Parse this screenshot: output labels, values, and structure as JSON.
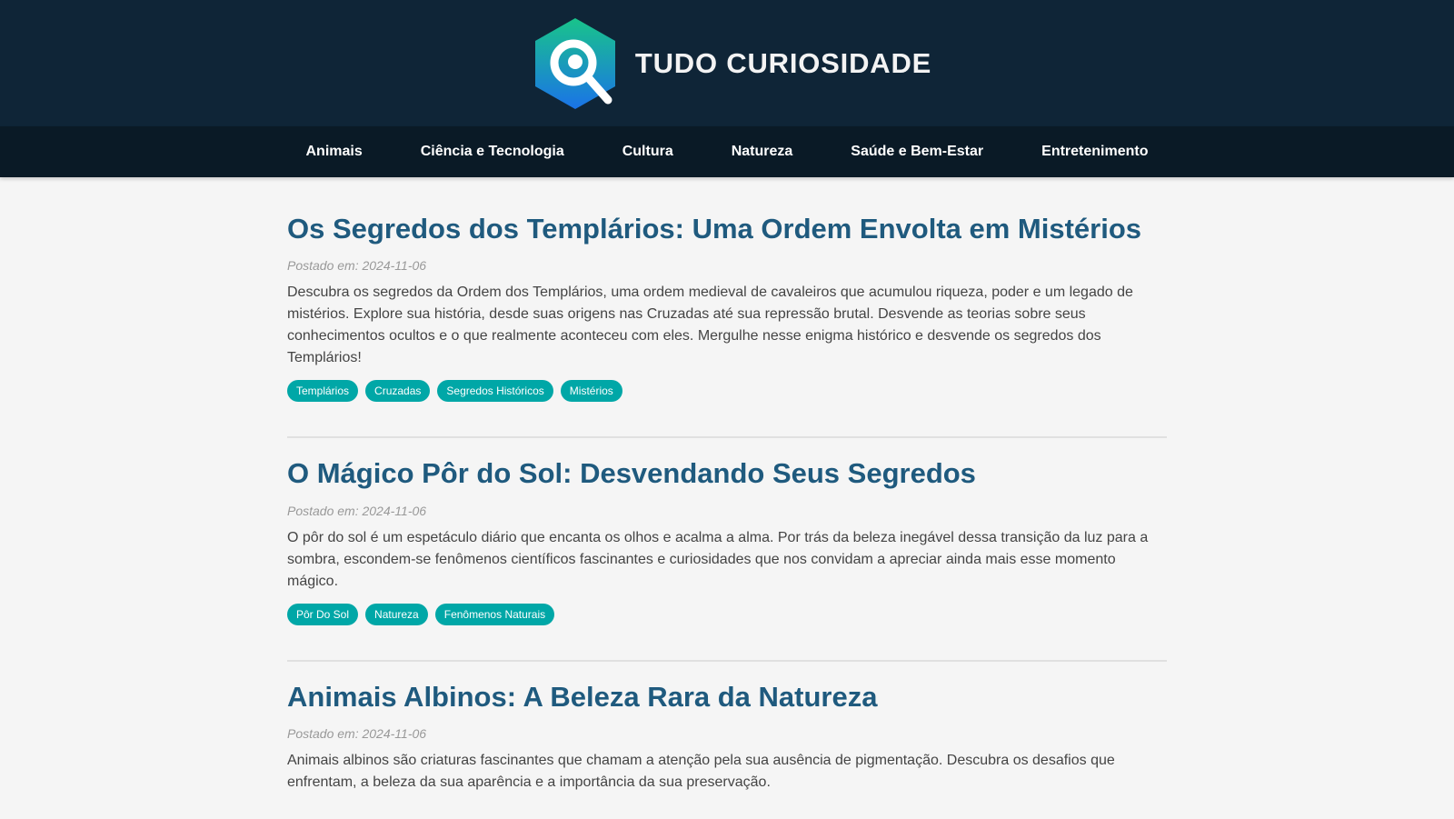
{
  "site": {
    "name": "TUDO CURIOSIDADE",
    "logo_icon": "magnifier-hexagon-icon",
    "colors": {
      "header_bg": "#0f2537",
      "nav_bg": "#0a1a26",
      "title": "#1f5a7e",
      "tag_bg": "#00a7a7",
      "logo_gradient_top": "#19c48a",
      "logo_gradient_bottom": "#1a73e8"
    }
  },
  "nav": {
    "items": [
      {
        "label": "Animais"
      },
      {
        "label": "Ciência e Tecnologia"
      },
      {
        "label": "Cultura"
      },
      {
        "label": "Natureza"
      },
      {
        "label": "Saúde e Bem-Estar"
      },
      {
        "label": "Entretenimento"
      }
    ]
  },
  "posts": [
    {
      "title": "Os Segredos dos Templários: Uma Ordem Envolta em Mistérios",
      "date": "Postado em: 2024-11-06",
      "excerpt": "Descubra os segredos da Ordem dos Templários, uma ordem medieval de cavaleiros que acumulou riqueza, poder e um legado de mistérios. Explore sua história, desde suas origens nas Cruzadas até sua repressão brutal. Desvende as teorias sobre seus conhecimentos ocultos e o que realmente aconteceu com eles. Mergulhe nesse enigma histórico e desvende os segredos dos Templários!",
      "tags": [
        "Templários",
        "Cruzadas",
        "Segredos Históricos",
        "Mistérios"
      ]
    },
    {
      "title": "O Mágico Pôr do Sol: Desvendando Seus Segredos",
      "date": "Postado em: 2024-11-06",
      "excerpt": "O pôr do sol é um espetáculo diário que encanta os olhos e acalma a alma. Por trás da beleza inegável dessa transição da luz para a sombra, escondem-se fenômenos científicos fascinantes e curiosidades que nos convidam a apreciar ainda mais esse momento mágico.",
      "tags": [
        "Pôr Do Sol",
        "Natureza",
        "Fenômenos Naturais"
      ]
    },
    {
      "title": "Animais Albinos: A Beleza Rara da Natureza",
      "date": "Postado em: 2024-11-06",
      "excerpt": "Animais albinos são criaturas fascinantes que chamam a atenção pela sua ausência de pigmentação. Descubra os desafios que enfrentam, a beleza da sua aparência e a importância da sua preservação.",
      "tags": []
    }
  ]
}
